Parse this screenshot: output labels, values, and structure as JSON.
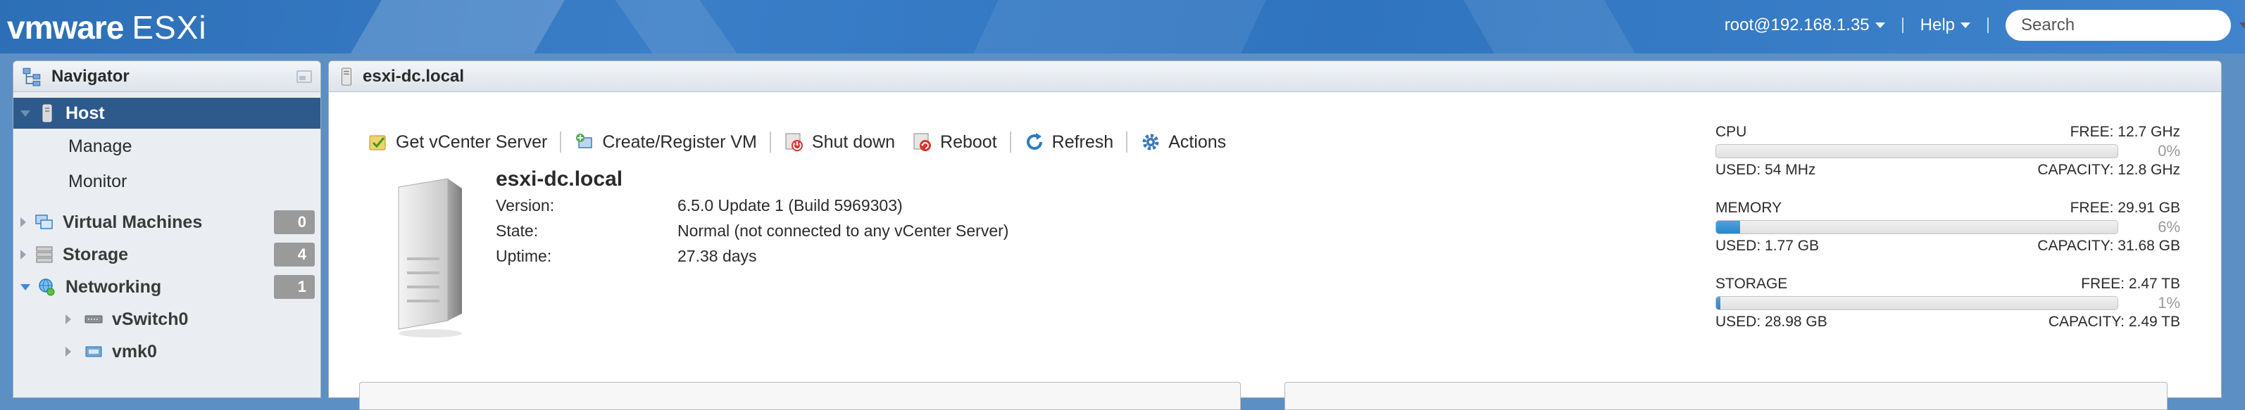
{
  "brand": {
    "vendor": "vmware",
    "product": "ESXi"
  },
  "header": {
    "user": "root@192.168.1.35",
    "help": "Help",
    "search_placeholder": "Search"
  },
  "navigator": {
    "title": "Navigator",
    "host": "Host",
    "host_children": [
      "Manage",
      "Monitor"
    ],
    "groups": [
      {
        "label": "Virtual Machines",
        "count": "0",
        "expanded": false
      },
      {
        "label": "Storage",
        "count": "4",
        "expanded": false
      },
      {
        "label": "Networking",
        "count": "1",
        "expanded": true
      }
    ],
    "networking_children": [
      "vSwitch0",
      "vmk0"
    ]
  },
  "main": {
    "title": "esxi-dc.local",
    "toolbar": {
      "get_vcenter": "Get vCenter Server",
      "create_vm": "Create/Register VM",
      "shutdown": "Shut down",
      "reboot": "Reboot",
      "refresh": "Refresh",
      "actions": "Actions"
    },
    "host": {
      "name": "esxi-dc.local",
      "props": [
        {
          "label": "Version:",
          "value": "6.5.0 Update 1 (Build 5969303)"
        },
        {
          "label": "State:",
          "value": "Normal (not connected to any vCenter Server)"
        },
        {
          "label": "Uptime:",
          "value": "27.38 days"
        }
      ]
    },
    "stats": [
      {
        "name": "CPU",
        "free": "FREE: 12.7 GHz",
        "pct": "0%",
        "pct_value": 0,
        "used": "USED: 54 MHz",
        "capacity": "CAPACITY: 12.8 GHz"
      },
      {
        "name": "MEMORY",
        "free": "FREE: 29.91 GB",
        "pct": "6%",
        "pct_value": 6,
        "used": "USED: 1.77 GB",
        "capacity": "CAPACITY: 31.68 GB"
      },
      {
        "name": "STORAGE",
        "free": "FREE: 2.47 TB",
        "pct": "1%",
        "pct_value": 1,
        "used": "USED: 28.98 GB",
        "capacity": "CAPACITY: 2.49 TB"
      }
    ]
  },
  "colors": {
    "accent": "#2d5a8b",
    "topbar": "#3a7ec8",
    "bar_fill": "#2a86c9",
    "badge": "#9a9a9a"
  }
}
